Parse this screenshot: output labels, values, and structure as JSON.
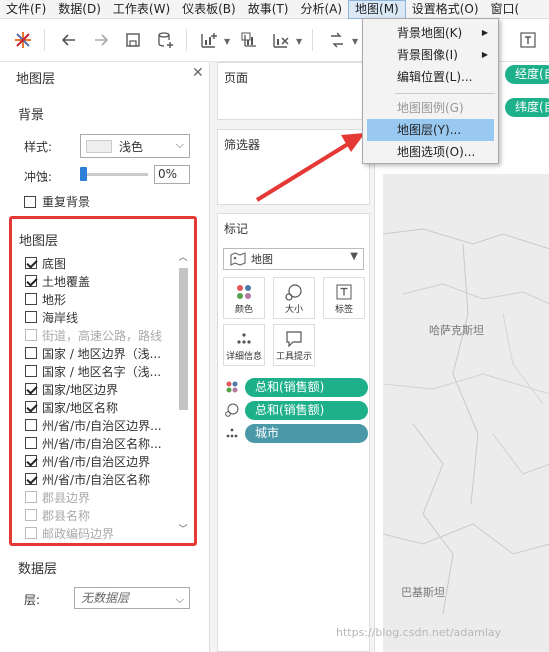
{
  "menubar": {
    "items": [
      "文件(F)",
      "数据(D)",
      "工作表(W)",
      "仪表板(B)",
      "故事(T)",
      "分析(A)",
      "地图(M)",
      "设置格式(O)",
      "窗口("
    ]
  },
  "dropdown": {
    "items": [
      {
        "label": "背景地图(K)",
        "submenu": true
      },
      {
        "label": "背景图像(I)",
        "submenu": true
      },
      {
        "label": "编辑位置(L)..."
      },
      {
        "label": "地图图例(G)",
        "disabled": true
      },
      {
        "label": "地图层(Y)...",
        "highlighted": true
      },
      {
        "label": "地图选项(O)..."
      }
    ]
  },
  "left_panel": {
    "title": "地图层",
    "background_section": "背景",
    "style_label": "样式:",
    "style_value": "浅色",
    "wash_label": "冲蚀:",
    "wash_value": "0%",
    "repeat_label": "重复背景",
    "layers_title": "地图层",
    "layers": [
      {
        "label": "底图",
        "checked": true,
        "disabled": false
      },
      {
        "label": "土地覆盖",
        "checked": true,
        "disabled": false
      },
      {
        "label": "地形",
        "checked": false,
        "disabled": false
      },
      {
        "label": "海岸线",
        "checked": false,
        "disabled": false
      },
      {
        "label": "街道，高速公路，路线",
        "checked": false,
        "disabled": true
      },
      {
        "label": "国家 / 地区边界（浅...",
        "checked": false,
        "disabled": false
      },
      {
        "label": "国家 / 地区名字（浅...",
        "checked": false,
        "disabled": false
      },
      {
        "label": "国家/地区边界",
        "checked": true,
        "disabled": false
      },
      {
        "label": "国家/地区名称",
        "checked": true,
        "disabled": false
      },
      {
        "label": "州/省/市/自治区边界...",
        "checked": false,
        "disabled": false
      },
      {
        "label": "州/省/市/自治区名称...",
        "checked": false,
        "disabled": false
      },
      {
        "label": "州/省/市/自治区边界",
        "checked": true,
        "disabled": false
      },
      {
        "label": "州/省/市/自治区名称",
        "checked": true,
        "disabled": false
      },
      {
        "label": "郡县边界",
        "checked": false,
        "disabled": true
      },
      {
        "label": "郡县名称",
        "checked": false,
        "disabled": true
      },
      {
        "label": "邮政编码边界",
        "checked": false,
        "disabled": true
      }
    ],
    "data_layer_title": "数据层",
    "data_layer_label": "层:",
    "data_layer_value": "无数据层"
  },
  "middle_panel": {
    "pages_title": "页面",
    "filters_title": "筛选器",
    "marks_title": "标记",
    "marks_type": "地图",
    "buttons": {
      "color": "颜色",
      "size": "大小",
      "label": "标签",
      "detail": "详细信息",
      "tooltip": "工具提示"
    },
    "pills": [
      "总和(销售额)",
      "总和(销售额)",
      "城市"
    ]
  },
  "right_area": {
    "columns_pill": "经度(自",
    "rows_pill": "纬度(自",
    "map_labels": [
      "哈萨克斯坦",
      "巴基斯坦"
    ]
  },
  "watermark": "https://blog.csdn.net/adamlay"
}
